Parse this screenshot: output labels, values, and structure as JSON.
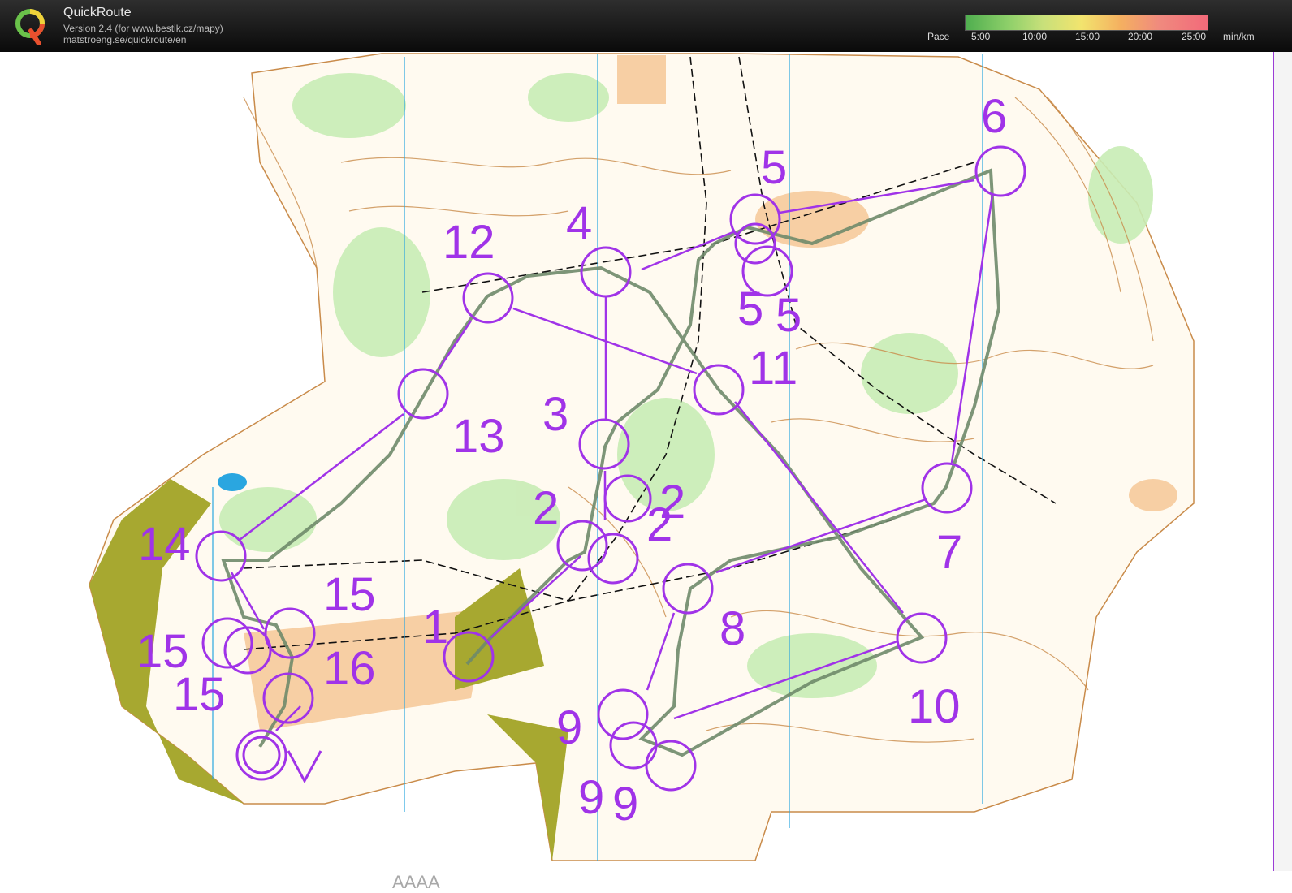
{
  "header": {
    "app_name": "QuickRoute",
    "version": "Version 2.4  (for www.bestik.cz/mapy)",
    "website": "matstroeng.se/quickroute/en",
    "pace_label": "Pace",
    "pace_ticks": [
      "5:00",
      "10:00",
      "15:00",
      "20:00",
      "25:00"
    ],
    "pace_unit": "min/km"
  },
  "map": {
    "watermark": "AAAA",
    "controls": [
      "1",
      "2",
      "2",
      "2",
      "3",
      "4",
      "5",
      "5",
      "5",
      "6",
      "7",
      "8",
      "9",
      "9",
      "9",
      "10",
      "11",
      "12",
      "13",
      "14",
      "15",
      "15",
      "15",
      "16"
    ],
    "course_color": "#a033e8",
    "route_color": "#6f8a6a"
  }
}
